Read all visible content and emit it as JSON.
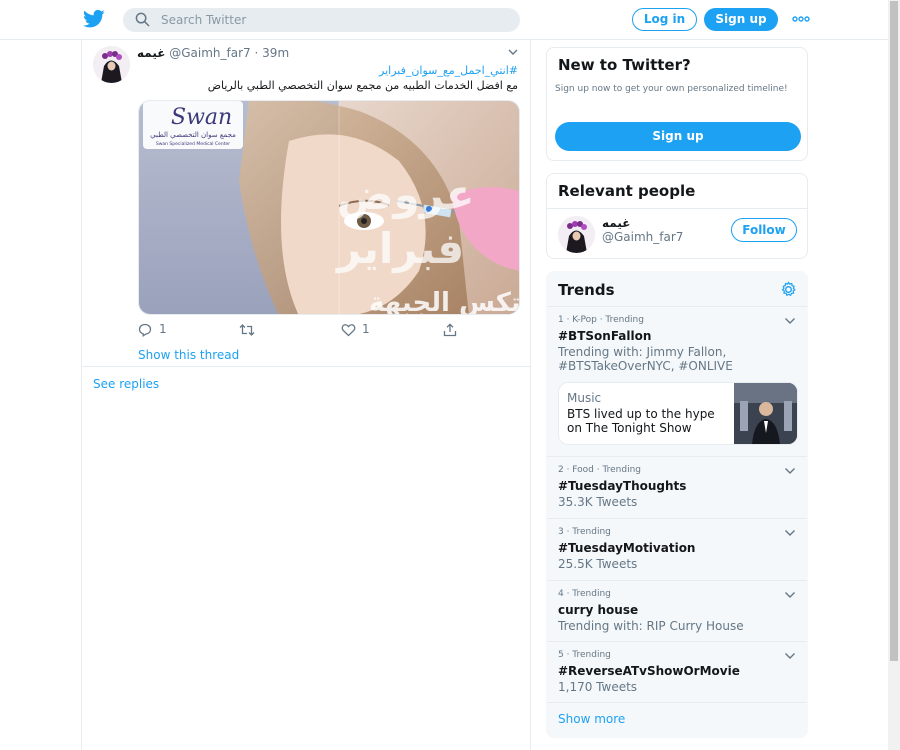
{
  "topbar": {
    "search_placeholder": "Search Twitter",
    "login_label": "Log in",
    "signup_label": "Sign up"
  },
  "tweet": {
    "author_name": "غيمه",
    "author_handle": "@Gaimh_far7",
    "time": "39m",
    "hashtag": "#انتي_اجمل_مع_سوان_فبراير",
    "text": "مع افضل الخدمات الطبيه من مجمع سوان التخصصي الطبي بالرياض",
    "media": {
      "brand": "Swan",
      "brand_sub_ar": "مجمع سوان التخصصي الطبي",
      "brand_sub_en": "Swan Specialized Medical Center",
      "promo_line1": "عروض",
      "promo_line2": "فبراير",
      "promo_line3": "بوتكس الجبهة"
    },
    "reply_count": "1",
    "retweet_count": "",
    "like_count": "1",
    "show_thread_label": "Show this thread"
  },
  "see_replies_label": "See replies",
  "new_to_twitter": {
    "title": "New to Twitter?",
    "description": "Sign up now to get your own personalized timeline!",
    "signup_label": "Sign up"
  },
  "relevant_people": {
    "title": "Relevant people",
    "name": "غيمه",
    "handle": "@Gaimh_far7",
    "follow_label": "Follow"
  },
  "trends": {
    "title": "Trends",
    "items": [
      {
        "rank": "1 · K-Pop · Trending",
        "name": "#BTSonFallon",
        "sub": "Trending with: Jimmy Fallon, #BTSTakeOverNYC, #ONLIVE",
        "news_category": "Music",
        "news_title": "BTS lived up to the hype on The Tonight Show"
      },
      {
        "rank": "2 · Food · Trending",
        "name": "#TuesdayThoughts",
        "sub": "35.3K Tweets"
      },
      {
        "rank": "3 · Trending",
        "name": "#TuesdayMotivation",
        "sub": "25.5K Tweets"
      },
      {
        "rank": "4 · Trending",
        "name": "curry house",
        "sub": "Trending with: RIP Curry House"
      },
      {
        "rank": "5 · Trending",
        "name": "#ReverseATvShowOrMovie",
        "sub": "1,170 Tweets"
      }
    ],
    "show_more_label": "Show more"
  },
  "colors": {
    "accent": "#1da1f2",
    "text_primary": "#14171a",
    "text_secondary": "#657786",
    "border": "#e6ecf0",
    "panel_bg": "#f5f8fa"
  }
}
